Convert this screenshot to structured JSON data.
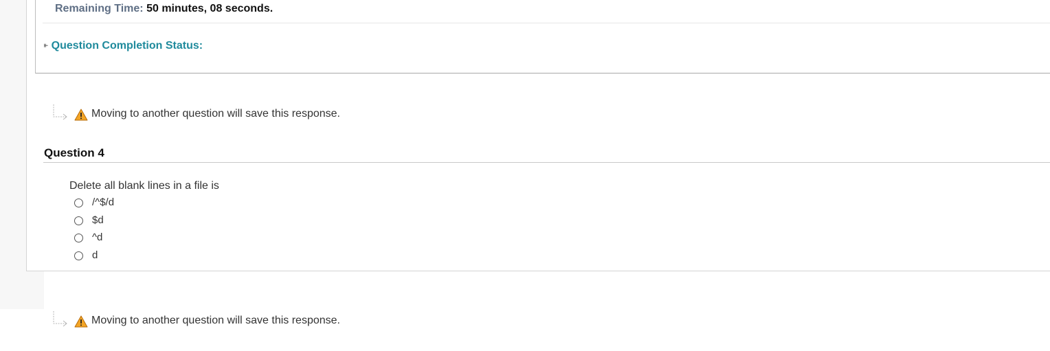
{
  "timer": {
    "label": "Remaining Time:",
    "value": "50 minutes, 08 seconds."
  },
  "completion_status": {
    "label": "Question Completion Status:",
    "icon": "double-chevron-down-icon"
  },
  "save_notice": {
    "text": "Moving to another question will save this response.",
    "icon": "warning-icon",
    "icon_color": "#f0a030"
  },
  "question": {
    "title": "Question 4",
    "text": "Delete all blank lines in a file is",
    "options": [
      {
        "label": "/^$/d"
      },
      {
        "label": "$d"
      },
      {
        "label": "^d"
      },
      {
        "label": "d"
      }
    ]
  },
  "colors": {
    "timer_label": "#5f6f85",
    "completion_link": "#1f8a9c"
  }
}
